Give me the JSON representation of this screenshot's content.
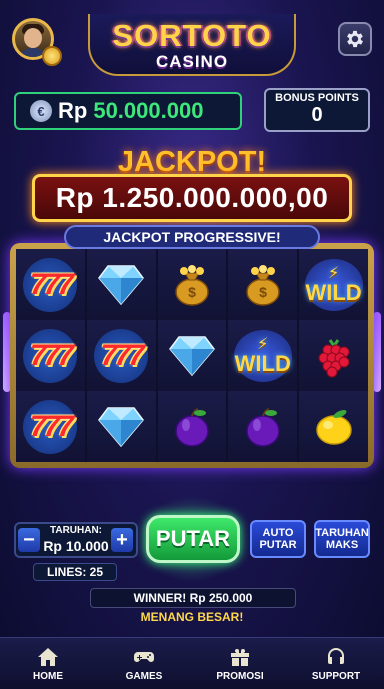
{
  "header": {
    "logo_main": "SORTOTO",
    "logo_sub": "CASINO"
  },
  "balance": {
    "currency": "Rp",
    "amount": "50.000.000"
  },
  "bonus": {
    "label": "BONUS POINTS",
    "value": "0"
  },
  "jackpot": {
    "title": "JACKPOT!",
    "amount": "Rp 1.250.000.000,00",
    "progressive_label": "JACKPOT PROGRESSIVE!"
  },
  "reels": {
    "rows": [
      [
        "777",
        "diamond",
        "money-bag",
        "money-bag",
        "wild"
      ],
      [
        "777",
        "777",
        "diamond",
        "wild",
        "raspberry"
      ],
      [
        "777",
        "diamond",
        "plum",
        "plum",
        "lemon"
      ]
    ],
    "wild_label": "WILD",
    "seven_label": "777"
  },
  "controls": {
    "bet_label": "TARUHAN:",
    "bet_value": "Rp 10.000",
    "minus": "−",
    "plus": "+",
    "lines": "LINES: 25",
    "spin_label": "PUTAR",
    "auto_label_1": "AUTO",
    "auto_label_2": "PUTAR",
    "max_label_1": "TARUHAN",
    "max_label_2": "MAKS"
  },
  "messages": {
    "winner": "WINNER! Rp 250.000",
    "big_win": "MENANG BESAR!"
  },
  "nav": {
    "items": [
      {
        "label": "HOME",
        "icon": "home-icon"
      },
      {
        "label": "GAMES",
        "icon": "gamepad-icon"
      },
      {
        "label": "PROMOSI",
        "icon": "gift-icon"
      },
      {
        "label": "SUPPORT",
        "icon": "headset-icon"
      }
    ]
  },
  "colors": {
    "accent_green": "#3ee77a",
    "gold": "#ffd44a",
    "jackpot_red": "#7a1010"
  }
}
